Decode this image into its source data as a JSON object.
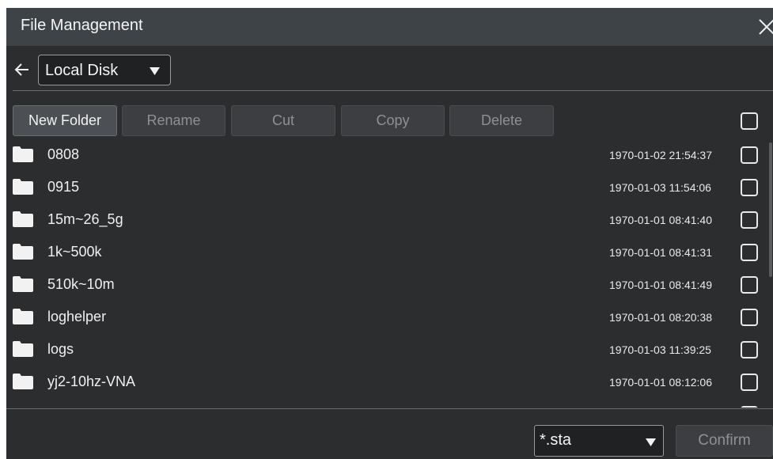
{
  "window": {
    "title": "File Management"
  },
  "location": {
    "disk": "Local Disk"
  },
  "toolbar": {
    "new_folder": "New Folder",
    "rename": "Rename",
    "cut": "Cut",
    "copy": "Copy",
    "delete": "Delete"
  },
  "files": [
    {
      "name": "0808",
      "date": "1970-01-02 21:54:37",
      "icon": "folder-icon"
    },
    {
      "name": "0915",
      "date": "1970-01-03 11:54:06",
      "icon": "folder-icon"
    },
    {
      "name": "15m~26_5g",
      "date": "1970-01-01 08:41:40",
      "icon": "folder-icon"
    },
    {
      "name": "1k~500k",
      "date": "1970-01-01 08:41:31",
      "icon": "folder-icon"
    },
    {
      "name": "510k~10m",
      "date": "1970-01-01 08:41:49",
      "icon": "folder-icon"
    },
    {
      "name": "loghelper",
      "date": "1970-01-01 08:20:38",
      "icon": "folder-icon"
    },
    {
      "name": "logs",
      "date": "1970-01-03 11:39:25",
      "icon": "folder-icon"
    },
    {
      "name": "yj2-10hz-VNA",
      "date": "1970-01-01 08:12:06",
      "icon": "folder-icon"
    }
  ],
  "footer": {
    "filter": "*.sta",
    "confirm": "Confirm"
  },
  "colors": {
    "background": "#2b2d2f",
    "titlebar": "#3d4347",
    "button": "#3c3e41",
    "button_active": "#4c5055",
    "text": "#f0f0f0",
    "text_disabled": "#8e9194"
  }
}
